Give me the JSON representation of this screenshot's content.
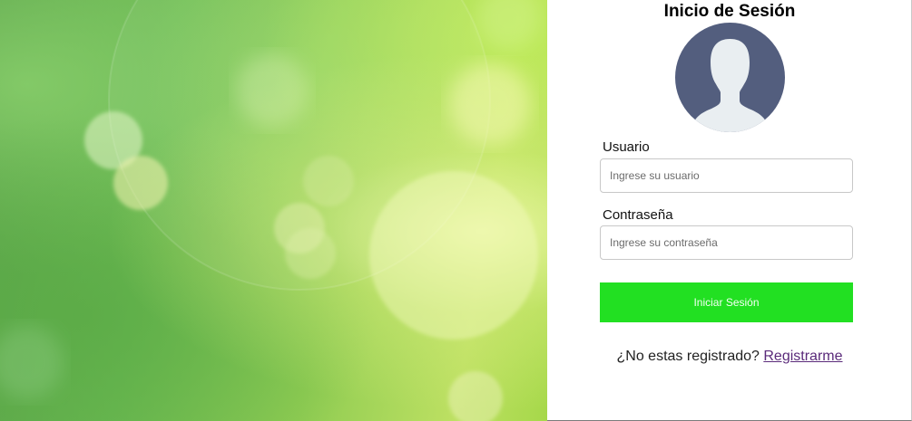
{
  "login": {
    "title": "Inicio de Sesión",
    "avatar_icon": "user-avatar-icon",
    "username": {
      "label": "Usuario",
      "placeholder": "Ingrese su usuario",
      "value": ""
    },
    "password": {
      "label": "Contraseña",
      "placeholder": "Ingrese su contraseña",
      "value": ""
    },
    "submit_label": "Iniciar Sesión",
    "register_prompt": "¿No estas registrado?",
    "register_link": "Registrarme"
  },
  "colors": {
    "submit_button": "#22e022",
    "avatar_background": "#535e7e",
    "avatar_silhouette": "#e9eef1",
    "register_link": "#5a2a7a"
  }
}
